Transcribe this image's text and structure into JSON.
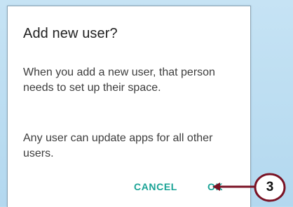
{
  "dialog": {
    "title": "Add new user?",
    "message_1": "When you add a new user, that person needs to set up their space.",
    "message_2": "Any user can update apps for all other users.",
    "cancel_label": "CANCEL",
    "ok_label": "OK"
  },
  "callout": {
    "number": "3"
  },
  "colors": {
    "accent": "#1aa396",
    "callout_line": "#7a1224",
    "backdrop": "#b9dcf1"
  }
}
